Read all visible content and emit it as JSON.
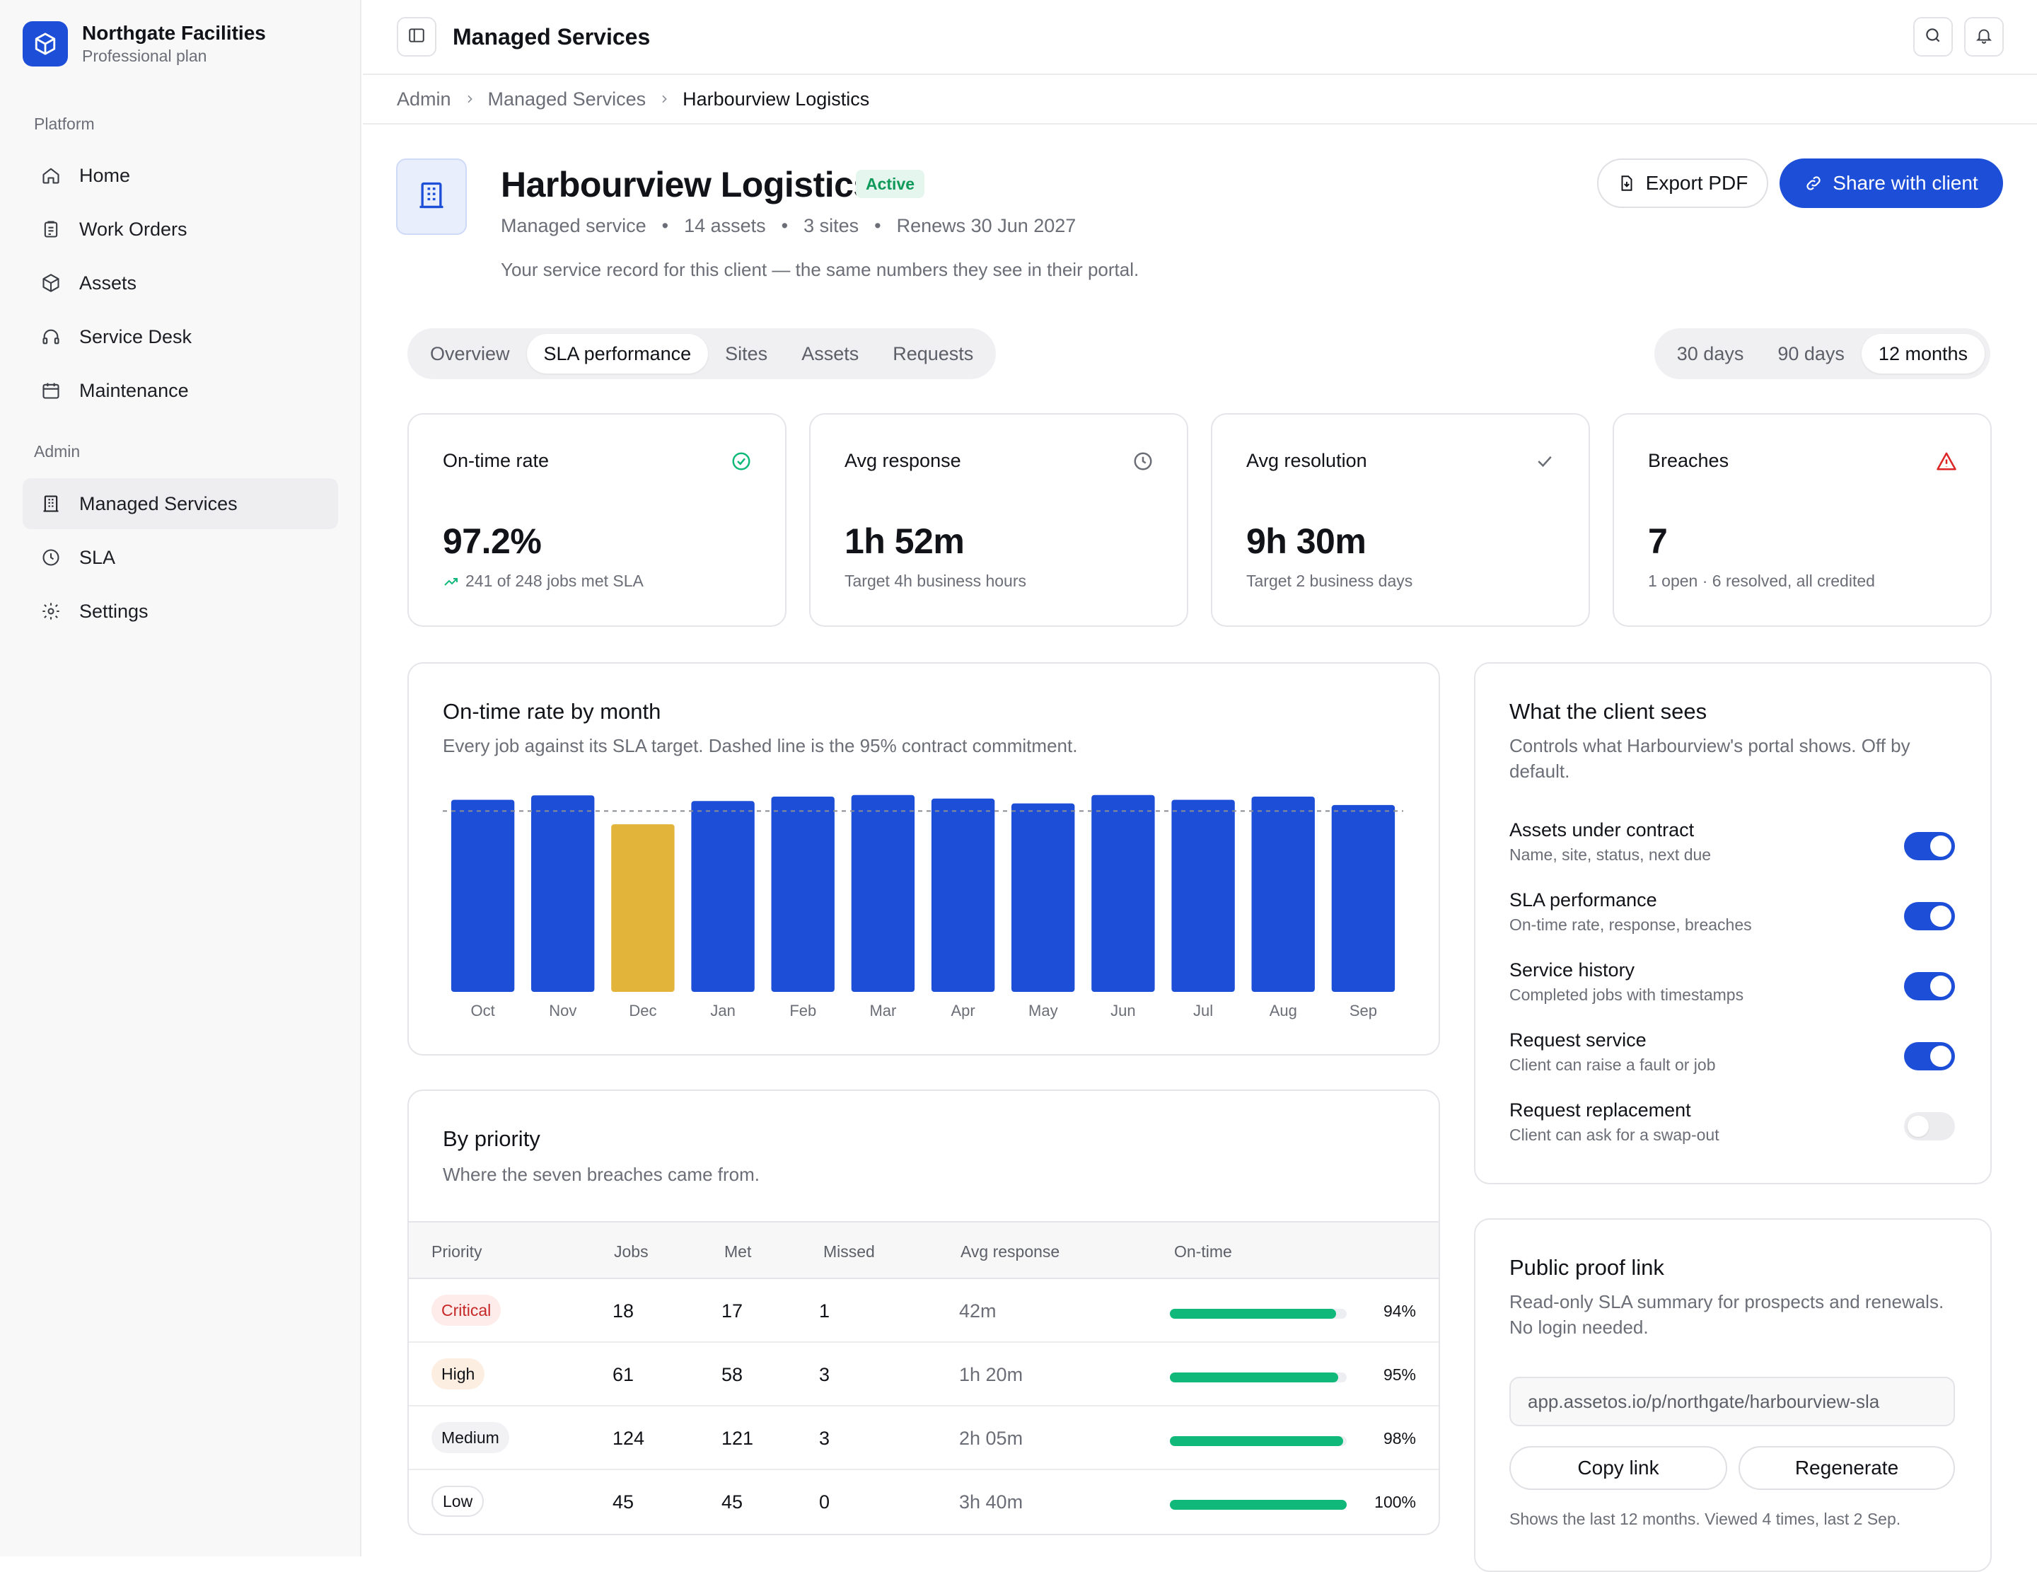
{
  "sidebar": {
    "brand": {
      "name": "Northgate Facilities",
      "plan": "Professional plan"
    },
    "sections": [
      {
        "title": "Platform",
        "items": [
          {
            "label": "Home",
            "icon": "home-icon"
          },
          {
            "label": "Work Orders",
            "icon": "clipboard-icon"
          },
          {
            "label": "Assets",
            "icon": "cube-icon"
          },
          {
            "label": "Service Desk",
            "icon": "headset-icon"
          },
          {
            "label": "Maintenance",
            "icon": "calendar-icon"
          }
        ]
      },
      {
        "title": "Admin",
        "items": [
          {
            "label": "Managed Services",
            "icon": "building-icon",
            "active": true
          },
          {
            "label": "SLA",
            "icon": "clock-icon"
          },
          {
            "label": "Settings",
            "icon": "gear-icon"
          }
        ]
      }
    ]
  },
  "topbar": {
    "title": "Managed Services"
  },
  "breadcrumb": [
    "Admin",
    "Managed Services",
    "Harbourview Logistics"
  ],
  "client": {
    "name": "Harbourview Logistics",
    "status": "Active",
    "meta": [
      "Managed service",
      "14 assets",
      "3 sites",
      "Renews 30 Jun 2027"
    ],
    "subtitle": "Your service record for this client — the same numbers they see in their portal.",
    "export_label": "Export PDF",
    "share_label": "Share with client"
  },
  "tabs": [
    "Overview",
    "SLA performance",
    "Sites",
    "Assets",
    "Requests"
  ],
  "active_tab": "SLA performance",
  "ranges": [
    "30 days",
    "90 days",
    "12 months"
  ],
  "active_range": "12 months",
  "kpis": [
    {
      "label": "On-time rate",
      "value": "97.2%",
      "sub": "241 of 248 jobs met SLA",
      "icon": "check-circle-icon"
    },
    {
      "label": "Avg response",
      "value": "1h 52m",
      "sub": "Target 4h business hours",
      "icon": "clock-icon"
    },
    {
      "label": "Avg resolution",
      "value": "9h 30m",
      "sub": "Target 2 business days",
      "icon": "check-icon"
    },
    {
      "label": "Breaches",
      "value": "7",
      "sub": "1 open · 6 resolved, all credited",
      "icon": "warning-icon"
    }
  ],
  "chart_card": {
    "title": "On-time rate by month",
    "desc": "Every job against its SLA target. Dashed line is the 95% contract commitment."
  },
  "chart_data": {
    "type": "bar",
    "categories": [
      "Oct",
      "Nov",
      "Dec",
      "Jan",
      "Feb",
      "Mar",
      "Apr",
      "May",
      "Jun",
      "Jul",
      "Aug",
      "Sep"
    ],
    "values": [
      97.8,
      98.9,
      91.7,
      97.5,
      98.6,
      99.0,
      98.1,
      96.9,
      99.0,
      97.8,
      98.6,
      96.5
    ],
    "highlight": {
      "category": "Dec",
      "color": "#e3b43a"
    },
    "bar_color": "#1d4ed8",
    "reference_line": 95,
    "ylim": [
      50,
      100
    ],
    "grid": false,
    "title": "On-time rate by month"
  },
  "priority_card": {
    "title": "By priority",
    "desc": "Where the seven breaches came from.",
    "columns": [
      "Priority",
      "Jobs",
      "Met",
      "Missed",
      "Avg response",
      "On-time"
    ],
    "rows": [
      {
        "priority": "Critical",
        "jobs": "18",
        "met": "17",
        "missed": "1",
        "avg": "42m",
        "pct": "94%",
        "ratio": 0.94,
        "bg": "#fdecea",
        "fg": "#c62828"
      },
      {
        "priority": "High",
        "jobs": "61",
        "met": "58",
        "missed": "3",
        "avg": "1h 20m",
        "pct": "95%",
        "ratio": 0.95,
        "bg": "#fdeee2",
        "fg": "#111318"
      },
      {
        "priority": "Medium",
        "jobs": "124",
        "met": "121",
        "missed": "3",
        "avg": "2h 05m",
        "pct": "98%",
        "ratio": 0.98,
        "bg": "#f2f2f4",
        "fg": "#111318"
      },
      {
        "priority": "Low",
        "jobs": "45",
        "met": "45",
        "missed": "0",
        "avg": "3h 40m",
        "pct": "100%",
        "ratio": 1.0,
        "bg": "#ffffff",
        "fg": "#111318"
      }
    ]
  },
  "client_view": {
    "title": "What the client sees",
    "desc": "Controls what Harbourview's portal shows. Off by default.",
    "toggles": [
      {
        "label": "Assets under contract",
        "sub": "Name, site, status, next due",
        "on": true
      },
      {
        "label": "SLA performance",
        "sub": "On-time rate, response, breaches",
        "on": true
      },
      {
        "label": "Service history",
        "sub": "Completed jobs with timestamps",
        "on": true
      },
      {
        "label": "Request service",
        "sub": "Client can raise a fault or job",
        "on": true
      },
      {
        "label": "Request replacement",
        "sub": "Client can ask for a swap-out",
        "on": false
      }
    ]
  },
  "proof_link": {
    "title": "Public proof link",
    "desc": "Read-only SLA summary for prospects and renewals. No login needed.",
    "url": "app.assetos.io/p/northgate/harbourview-sla",
    "copy_label": "Copy link",
    "regen_label": "Regenerate",
    "note": "Shows the last 12 months. Viewed 4 times, last 2 Sep."
  }
}
